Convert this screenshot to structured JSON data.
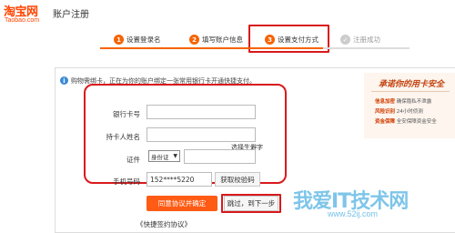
{
  "header": {
    "logo_cn": "淘宝网",
    "logo_en": "Taobao.com",
    "title": "账户注册"
  },
  "steps": [
    {
      "num": "1",
      "label": "设置登录名"
    },
    {
      "num": "2",
      "label": "填写账户信息"
    },
    {
      "num": "3",
      "label": "设置支付方式"
    },
    {
      "num": "✓",
      "label": "注册成功"
    }
  ],
  "notice": "购物需绑卡，正在为你的账户绑定一张常用银行卡开通快捷支付。",
  "form": {
    "bank_card_label": "银行卡号",
    "bank_card_value": "",
    "holder_name_label": "持卡人姓名",
    "holder_name_value": "",
    "rare_char_link": "选择生僻字",
    "id_label": "证件",
    "id_type_selected": "身份证",
    "id_value": "",
    "phone_label": "手机号码",
    "phone_value": "152****5220",
    "get_code_button": "获取校验码",
    "agree_button": "同意协议并确定",
    "skip_button": "跳过，到下一步",
    "agreement_link": "《快捷签约协议》"
  },
  "promo": {
    "title": "承诺你的用卡安全",
    "items": [
      {
        "bullet": "信息加密",
        "text": "确保隐私不泄露"
      },
      {
        "bullet": "风险识别",
        "text": "24小时侦测"
      },
      {
        "bullet": "资金保障",
        "text": "全安保障资金安全"
      }
    ]
  },
  "watermark": {
    "text": "我爱IT技术网",
    "url": "www.52ij.com"
  },
  "colors": {
    "brand_orange": "#ff4400",
    "step_orange": "#f76300",
    "highlight_red": "#d9191c",
    "button_orange": "#ff5b14"
  }
}
